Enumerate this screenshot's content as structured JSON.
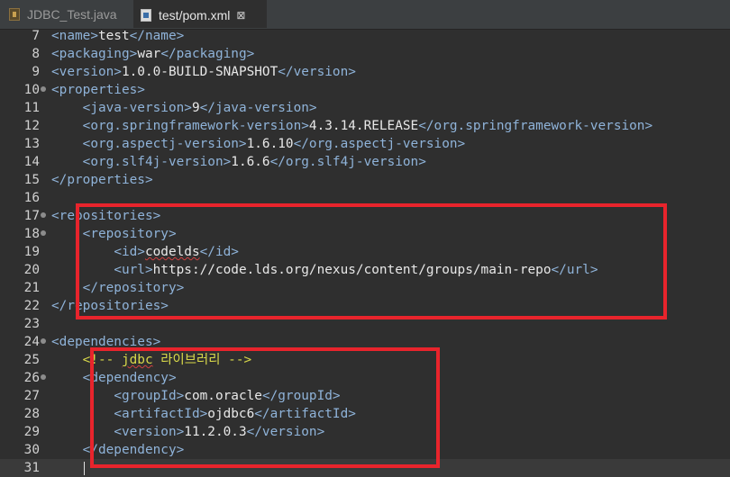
{
  "tabs": [
    {
      "label": "JDBC_Test.java",
      "icon": "java-file-icon",
      "active": false
    },
    {
      "label": "test/pom.xml",
      "icon": "pom-file-icon",
      "active": true,
      "close": "⊠"
    }
  ],
  "editor": {
    "lines": [
      {
        "num": "7",
        "fold": false,
        "parts": [
          {
            "t": "tag",
            "v": "<name>"
          },
          {
            "t": "txt",
            "v": "test"
          },
          {
            "t": "tag",
            "v": "</name>"
          }
        ]
      },
      {
        "num": "8",
        "fold": false,
        "parts": [
          {
            "t": "tag",
            "v": "<packaging>"
          },
          {
            "t": "txt",
            "v": "war"
          },
          {
            "t": "tag",
            "v": "</packaging>"
          }
        ]
      },
      {
        "num": "9",
        "fold": false,
        "parts": [
          {
            "t": "tag",
            "v": "<version>"
          },
          {
            "t": "txt",
            "v": "1.0.0-BUILD-SNAPSHOT"
          },
          {
            "t": "tag",
            "v": "</version>"
          }
        ]
      },
      {
        "num": "10",
        "fold": true,
        "parts": [
          {
            "t": "tag",
            "v": "<properties>"
          }
        ]
      },
      {
        "num": "11",
        "fold": false,
        "parts": [
          {
            "t": "txt",
            "v": "    "
          },
          {
            "t": "tag",
            "v": "<java-version>"
          },
          {
            "t": "txt",
            "v": "9"
          },
          {
            "t": "tag",
            "v": "</java-version>"
          }
        ]
      },
      {
        "num": "12",
        "fold": false,
        "parts": [
          {
            "t": "txt",
            "v": "    "
          },
          {
            "t": "tag",
            "v": "<org.springframework-version>"
          },
          {
            "t": "txt",
            "v": "4.3.14.RELEASE"
          },
          {
            "t": "tag",
            "v": "</org.springframework-version>"
          }
        ]
      },
      {
        "num": "13",
        "fold": false,
        "parts": [
          {
            "t": "txt",
            "v": "    "
          },
          {
            "t": "tag",
            "v": "<org.aspectj-version>"
          },
          {
            "t": "txt",
            "v": "1.6.10"
          },
          {
            "t": "tag",
            "v": "</org.aspectj-version>"
          }
        ]
      },
      {
        "num": "14",
        "fold": false,
        "parts": [
          {
            "t": "txt",
            "v": "    "
          },
          {
            "t": "tag",
            "v": "<org.slf4j-version>"
          },
          {
            "t": "txt",
            "v": "1.6.6"
          },
          {
            "t": "tag",
            "v": "</org.slf4j-version>"
          }
        ]
      },
      {
        "num": "15",
        "fold": false,
        "parts": [
          {
            "t": "tag",
            "v": "</properties>"
          }
        ]
      },
      {
        "num": "16",
        "fold": false,
        "parts": []
      },
      {
        "num": "17",
        "fold": true,
        "parts": [
          {
            "t": "tag",
            "v": "<repositories>"
          }
        ]
      },
      {
        "num": "18",
        "fold": true,
        "parts": [
          {
            "t": "txt",
            "v": "    "
          },
          {
            "t": "tag",
            "v": "<repository>"
          }
        ]
      },
      {
        "num": "19",
        "fold": false,
        "parts": [
          {
            "t": "txt",
            "v": "        "
          },
          {
            "t": "tag",
            "v": "<id>"
          },
          {
            "t": "squig",
            "v": "codelds"
          },
          {
            "t": "tag",
            "v": "</id>"
          }
        ]
      },
      {
        "num": "20",
        "fold": false,
        "parts": [
          {
            "t": "txt",
            "v": "        "
          },
          {
            "t": "tag",
            "v": "<url>"
          },
          {
            "t": "txt",
            "v": "https://code.lds.org/nexus/content/groups/main-repo"
          },
          {
            "t": "tag",
            "v": "</url>"
          }
        ]
      },
      {
        "num": "21",
        "fold": false,
        "parts": [
          {
            "t": "txt",
            "v": "    "
          },
          {
            "t": "tag",
            "v": "</repository>"
          }
        ]
      },
      {
        "num": "22",
        "fold": false,
        "parts": [
          {
            "t": "tag",
            "v": "</repositories>"
          }
        ]
      },
      {
        "num": "23",
        "fold": false,
        "parts": []
      },
      {
        "num": "24",
        "fold": true,
        "parts": [
          {
            "t": "tag",
            "v": "<dependencies>"
          }
        ]
      },
      {
        "num": "25",
        "fold": false,
        "parts": [
          {
            "t": "txt",
            "v": "    "
          },
          {
            "t": "cmt",
            "v": "<!-- "
          },
          {
            "t": "cmt squig",
            "v": "jdbc"
          },
          {
            "t": "cmt",
            "v": " 라이브러리 -->"
          }
        ]
      },
      {
        "num": "26",
        "fold": true,
        "parts": [
          {
            "t": "txt",
            "v": "    "
          },
          {
            "t": "tag",
            "v": "<dependency>"
          }
        ]
      },
      {
        "num": "27",
        "fold": false,
        "parts": [
          {
            "t": "txt",
            "v": "        "
          },
          {
            "t": "tag",
            "v": "<groupId>"
          },
          {
            "t": "txt",
            "v": "com.oracle"
          },
          {
            "t": "tag",
            "v": "</groupId>"
          }
        ]
      },
      {
        "num": "28",
        "fold": false,
        "parts": [
          {
            "t": "txt",
            "v": "        "
          },
          {
            "t": "tag",
            "v": "<artifactId>"
          },
          {
            "t": "txt",
            "v": "ojdbc6"
          },
          {
            "t": "tag",
            "v": "</artifactId>"
          }
        ]
      },
      {
        "num": "29",
        "fold": false,
        "parts": [
          {
            "t": "txt",
            "v": "        "
          },
          {
            "t": "tag",
            "v": "<version>"
          },
          {
            "t": "txt",
            "v": "11.2.0.3"
          },
          {
            "t": "tag",
            "v": "</version>"
          }
        ]
      },
      {
        "num": "30",
        "fold": false,
        "parts": [
          {
            "t": "txt",
            "v": "    "
          },
          {
            "t": "tag",
            "v": "</dependency>"
          }
        ]
      },
      {
        "num": "31",
        "fold": false,
        "parts": [],
        "current": true
      }
    ]
  },
  "annotation_color": "#e8242c"
}
